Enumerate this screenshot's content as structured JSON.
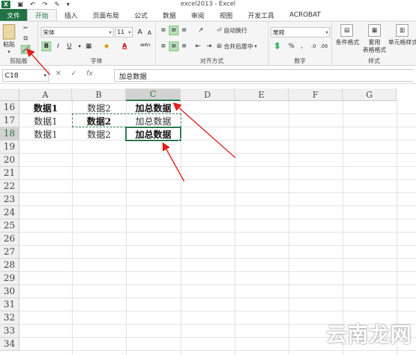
{
  "window": {
    "title": "excel2013 - Excel",
    "logo": "X"
  },
  "tabs": [
    {
      "label": "文件"
    },
    {
      "label": "开始"
    },
    {
      "label": "插入"
    },
    {
      "label": "页面布局"
    },
    {
      "label": "公式"
    },
    {
      "label": "数据"
    },
    {
      "label": "审阅"
    },
    {
      "label": "视图"
    },
    {
      "label": "开发工具"
    },
    {
      "label": "ACROBAT"
    }
  ],
  "ribbon": {
    "clipboard": {
      "paste_label": "粘贴",
      "group_label": "剪贴板"
    },
    "font": {
      "group_label": "字体",
      "font_name": "宋体",
      "font_size": "11",
      "bold": "B",
      "italic": "I",
      "underline": "U",
      "grow": "A",
      "shrink": "A",
      "wen": "wén"
    },
    "alignment": {
      "group_label": "对齐方式",
      "wrap_label": "自动换行",
      "merge_label": "合并后居中"
    },
    "number": {
      "group_label": "数字",
      "format": "常规",
      "percent": "%",
      "comma": ","
    },
    "styles": {
      "group_label": "样式",
      "conditional": "条件格式",
      "table_format_line1": "套用",
      "table_format_line2": "表格格式",
      "cell_styles": "单元格样式"
    }
  },
  "formula_bar": {
    "name_box": "C18",
    "cancel": "✕",
    "enter": "✓",
    "fx": "fx",
    "content": "加总数据"
  },
  "grid": {
    "columns": [
      "A",
      "B",
      "C",
      "D",
      "E",
      "F",
      "G"
    ],
    "rows": [
      "16",
      "17",
      "18",
      "19",
      "20",
      "21",
      "22",
      "23",
      "24",
      "25",
      "26",
      "27",
      "28",
      "29",
      "30",
      "31",
      "32",
      "33",
      "34"
    ],
    "cells": {
      "a16": "数据1",
      "b16": "数据2",
      "c16": "加总数据",
      "a17": "数据1",
      "b17": "数据2",
      "c17": "加总数据",
      "a18": "数据1",
      "b18": "数据2",
      "c18": "加总数据"
    }
  },
  "watermark": "云南龙网",
  "colors": {
    "accent": "#217346",
    "arrow": "#e02020"
  }
}
